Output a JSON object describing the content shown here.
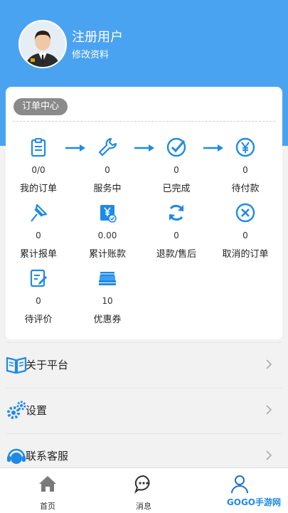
{
  "profile": {
    "name": "注册用户",
    "edit_label": "修改资料"
  },
  "order_center": {
    "title": "订单中心",
    "row1": [
      {
        "icon": "clipboard-icon",
        "count": "0/0",
        "label": "我的订单"
      },
      {
        "icon": "wrench-icon",
        "count": "0",
        "label": "服务中"
      },
      {
        "icon": "check-circle-icon",
        "count": "0",
        "label": "已完成"
      },
      {
        "icon": "yen-circle-icon",
        "count": "0",
        "label": "待付款"
      }
    ],
    "row2": [
      {
        "icon": "pin-icon",
        "count": "0",
        "label": "累计报单"
      },
      {
        "icon": "yen-card-icon",
        "count": "0.00",
        "label": "累计账款"
      },
      {
        "icon": "refresh-icon",
        "count": "0",
        "label": "退款/售后"
      },
      {
        "icon": "x-circle-icon",
        "count": "0",
        "label": "取消的订单"
      }
    ],
    "row3": [
      {
        "icon": "edit-note-icon",
        "count": "0",
        "label": "待评价"
      },
      {
        "icon": "coupon-stack-icon",
        "count": "10",
        "label": "优惠券"
      }
    ]
  },
  "menu": [
    {
      "icon": "book-icon",
      "label": "关于平台"
    },
    {
      "icon": "gears-icon",
      "label": "设置"
    },
    {
      "icon": "headset-icon",
      "label": "联系客服"
    }
  ],
  "tabbar": [
    {
      "icon": "home-icon",
      "label": "首页"
    },
    {
      "icon": "chat-icon",
      "label": "消息"
    },
    {
      "icon": "person-icon",
      "label": "我的"
    }
  ],
  "watermark": "GOGO手游网",
  "colors": {
    "primary": "#4aa3f0",
    "icon_blue": "#1f8ae6"
  }
}
